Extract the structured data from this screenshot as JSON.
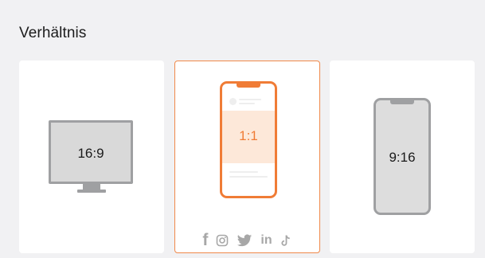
{
  "section": {
    "title": "Verhältnis"
  },
  "ratios": [
    {
      "label": "16:9"
    },
    {
      "label": "1:1"
    },
    {
      "label": "9:16"
    }
  ],
  "selected_ratio": "1:1",
  "accent_color": "#f07c36",
  "social_icons": [
    "facebook-icon",
    "instagram-icon",
    "twitter-icon",
    "linkedin-icon",
    "tiktok-icon"
  ],
  "social_text": {
    "facebook": "f",
    "linkedin": "in"
  }
}
